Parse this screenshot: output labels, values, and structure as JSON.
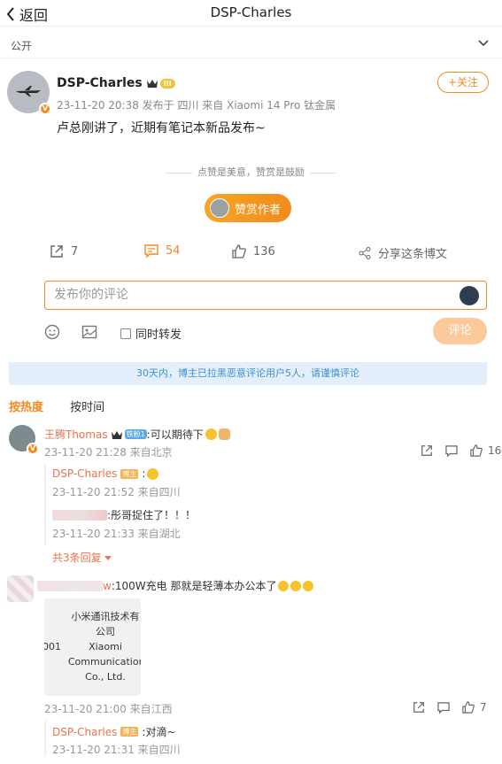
{
  "nav": {
    "back_label": "返回",
    "title": "DSP-Charles"
  },
  "visibility": {
    "label": "公开"
  },
  "post": {
    "author": "DSP-Charles",
    "level_badge": "III",
    "meta": "23-11-20 20:38  发布于 四川  来自 Xiaomi 14 Pro 钛金属",
    "follow_label": "+关注",
    "text": "卢总刚讲了，近期有笔记本新品发布~",
    "divider_text": "点赞是美意，赞赏是鼓励",
    "reward_label": "赞赏作者"
  },
  "actions": {
    "repost_count": "7",
    "comment_count": "54",
    "like_count": "136",
    "share_label": "分享这条博文"
  },
  "composer": {
    "placeholder": "发布你的评论",
    "repost_label": "同时转发",
    "submit_label": "评论"
  },
  "notice": "30天内，博主已拉黑恶意评论用户5人，请谨慎评论",
  "sort": {
    "hot": "按热度",
    "time": "按时间"
  },
  "comments": [
    {
      "name": "王腾Thomas",
      "badge": "铁粉1",
      "text": ":可以期待下",
      "meta": "23-11-20 21:28 来自北京",
      "likes": "16",
      "replies": [
        {
          "name": "DSP-Charles",
          "badge": "博主",
          "text": ":",
          "meta": "23-11-20 21:52 来自四川"
        },
        {
          "name": "",
          "text": ":彤哥捉住了！！！",
          "meta": "23-11-20 21:33 来自湖北"
        }
      ],
      "more_label": "共3条回复"
    },
    {
      "name": "w",
      "text": ":100W充电 那就是轻薄本办公本了",
      "card_lines": [
        "小米通讯技术有",
        "公司",
        "Xiaomi",
        "Communicatior",
        "Co., Ltd."
      ],
      "card_side": "001",
      "meta": "23-11-20 21:00 来自江西",
      "likes": "7",
      "replies": [
        {
          "name": "DSP-Charles",
          "badge": "博主",
          "text": ":对滴~",
          "meta": "23-11-20 21:31 来自四川"
        }
      ]
    }
  ]
}
